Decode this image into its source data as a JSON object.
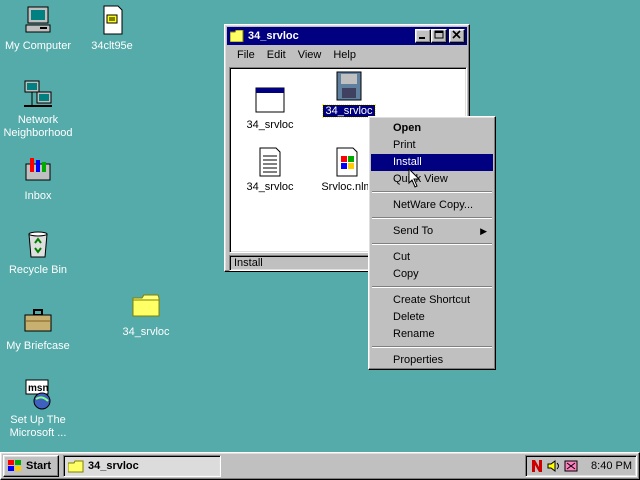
{
  "desktop": {
    "icons": [
      {
        "label": "My Computer"
      },
      {
        "label": "34clt95e"
      },
      {
        "label": "Network Neighborhood"
      },
      {
        "label": "Inbox"
      },
      {
        "label": "Recycle Bin"
      },
      {
        "label": "34_srvloc"
      },
      {
        "label": "My Briefcase"
      },
      {
        "label": "Set Up The Microsoft ..."
      }
    ]
  },
  "window": {
    "title": "34_srvloc",
    "menu": [
      "File",
      "Edit",
      "View",
      "Help"
    ],
    "files": [
      {
        "label": "34_srvloc"
      },
      {
        "label": "34_srvloc"
      },
      {
        "label": "34_srvloc"
      },
      {
        "label": "Srvloc.nlm"
      }
    ],
    "status": "Install"
  },
  "context_menu": {
    "items": [
      "Open",
      "Print",
      "Install",
      "Quick View",
      "NetWare Copy...",
      "Send To",
      "Cut",
      "Copy",
      "Create Shortcut",
      "Delete",
      "Rename",
      "Properties"
    ]
  },
  "taskbar": {
    "start": "Start",
    "task": "34_srvloc",
    "clock": "8:40 PM"
  },
  "colors": {
    "desktop": "#55aaaa",
    "title_bar": "#000080",
    "selection": "#000080",
    "face": "#c0c0c0"
  }
}
